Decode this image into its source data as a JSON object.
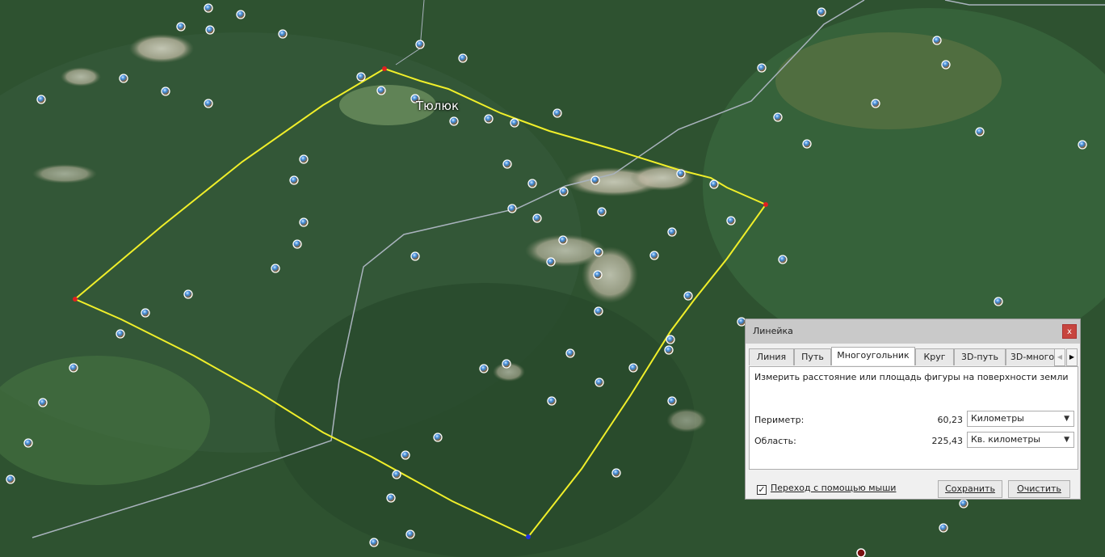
{
  "map": {
    "place_label": "Тюлюк",
    "polygon_color": "#f0ef2a",
    "road_color": "#a9b3bd"
  },
  "ruler": {
    "title": "Линейка",
    "close_label": "x",
    "tabs": [
      {
        "label": "Линия"
      },
      {
        "label": "Путь"
      },
      {
        "label": "Многоугольник",
        "active": true
      },
      {
        "label": "Круг"
      },
      {
        "label": "3D-путь"
      },
      {
        "label": "3D-много"
      }
    ],
    "description": "Измерить расстояние или площадь фигуры на поверхности земли",
    "perimeter": {
      "label": "Периметр:",
      "value": "60,23",
      "unit": "Километры"
    },
    "area": {
      "label": "Область:",
      "value": "225,43",
      "unit": "Кв. километры"
    },
    "mouse_nav": {
      "checked": true,
      "label": "Переход с помощью мыши"
    },
    "save_label": "Сохранить",
    "clear_label": "Очистить"
  }
}
